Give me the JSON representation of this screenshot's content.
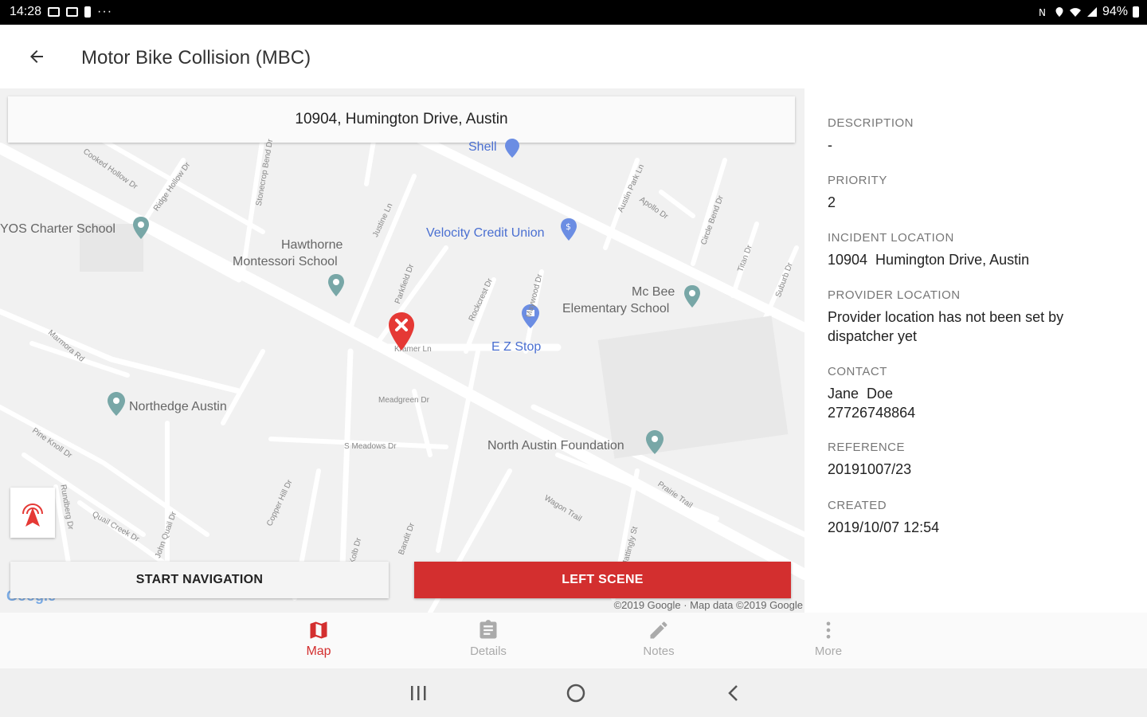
{
  "status_bar": {
    "time": "14:28",
    "overflow": "···",
    "battery": "94%"
  },
  "app_bar": {
    "title": "Motor Bike Collision (MBC)",
    "back_icon": "arrow-left-icon"
  },
  "map": {
    "address": "10904, Humington Drive, Austin",
    "pois": {
      "charter": "YOS Charter School",
      "hawthorne_1": "Hawthorne",
      "hawthorne_2": "Montessori School",
      "velocity": "Velocity Credit Union",
      "mcbee_1": "Mc Bee",
      "mcbee_2": "Elementary School",
      "ezstop": "E Z Stop",
      "northedge": "Northedge Austin",
      "nafoundation": "North Austin Foundation",
      "shell": "Shell"
    },
    "streets": {
      "cooked_hollow": "Cooked Hollow Dr",
      "ridge_hollow": "Ridge Hollow Dr",
      "stonecrop": "Stonecrop Bend Dr",
      "justine": "Justine Ln",
      "parkfield": "Parkfield Dr",
      "rundberg": "Rundberg Dr",
      "rockcrest": "Rockcrest Dr",
      "austin_park": "Austin Park Ln",
      "apollo": "Apollo Dr",
      "circle_bend": "Circle Bend Dr",
      "titan": "Titan Dr",
      "suburb": "Suburb Dr",
      "marmora": "Marmora Rd",
      "kramer": "Kramer Ln",
      "meadgreen": "Meadgreen Dr",
      "s_meadows": "S Meadows Dr",
      "pine_knoll": "Pine Knoll Dr",
      "quail_creek": "Quail Creek Dr",
      "john_quail": "John Quail Dr",
      "copper_hill": "Copper Hill Dr",
      "kolb": "Kolb Dr",
      "bandit": "Bandit Dr",
      "wagon": "Wagon Trail",
      "prairie": "Prairie Trail",
      "mattingly": "Mattingly St",
      "maywood": "Maywood Dr"
    },
    "start_navigation": "START NAVIGATION",
    "left_scene": "LEFT SCENE",
    "attribution": "©2019 Google · Map data ©2019 Google",
    "google_logo": "Google",
    "incident_pin_icon": "incident-marker-icon",
    "locate_icon": "location-broadcast-icon"
  },
  "details": {
    "description": {
      "label": "DESCRIPTION",
      "value": "-"
    },
    "priority": {
      "label": "PRIORITY",
      "value": "2"
    },
    "incident_location": {
      "label": "INCIDENT LOCATION",
      "value": "10904  Humington Drive, Austin"
    },
    "provider_location": {
      "label": "PROVIDER LOCATION",
      "value": "Provider location has not been set by dispatcher yet"
    },
    "contact": {
      "label": "CONTACT",
      "name": "Jane  Doe",
      "phone": "27726748864"
    },
    "reference": {
      "label": "REFERENCE",
      "value": "20191007/23"
    },
    "created": {
      "label": "CREATED",
      "value": "2019/10/07 12:54"
    }
  },
  "bottom_nav": {
    "items": [
      {
        "label": "Map",
        "icon": "map-icon",
        "active": true
      },
      {
        "label": "Details",
        "icon": "clipboard-icon",
        "active": false
      },
      {
        "label": "Notes",
        "icon": "pencil-icon",
        "active": false
      },
      {
        "label": "More",
        "icon": "more-vertical-icon",
        "active": false
      }
    ]
  },
  "system_nav": {
    "recents_icon": "recents-icon",
    "home_icon": "home-icon",
    "back_icon": "back-chevron-icon"
  },
  "colors": {
    "accent": "#d32f2f",
    "poi_blue": "#4a6fd1",
    "map_bg": "#f1f1f1",
    "road": "#ffffff"
  }
}
